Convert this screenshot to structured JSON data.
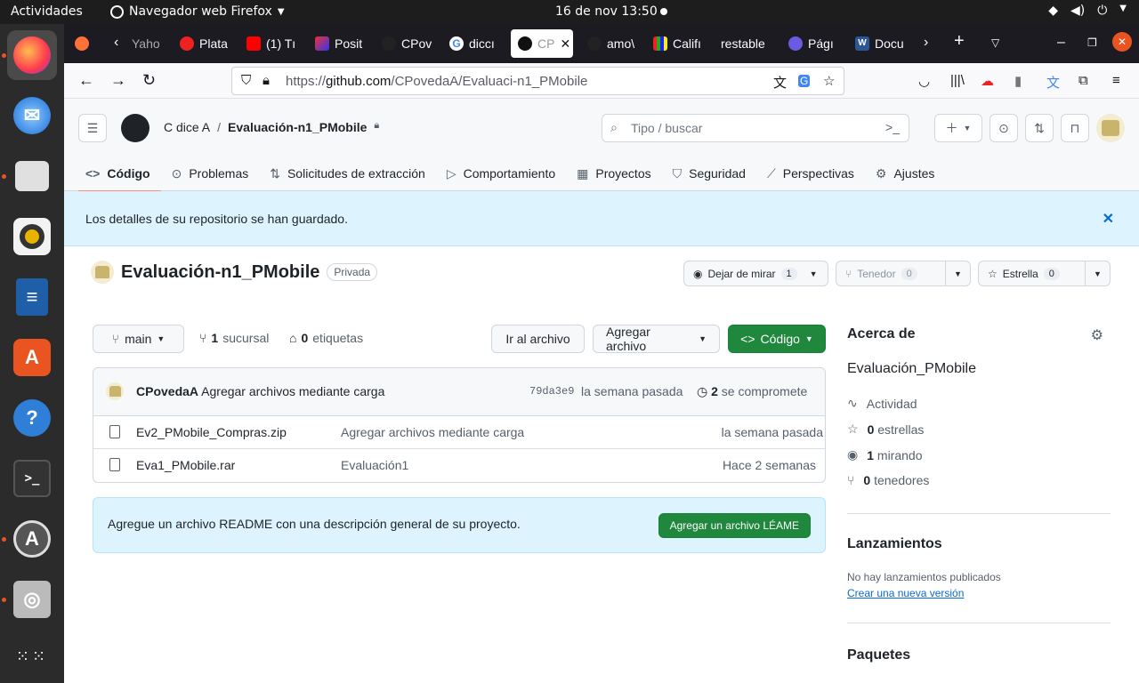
{
  "os": {
    "activities": "Actividades",
    "app_name": "Navegador web Firefox",
    "clock": "16 de nov  13:50"
  },
  "tabs": [
    {
      "label": "Yaho"
    },
    {
      "label": "Plata"
    },
    {
      "label": "(1) Tı"
    },
    {
      "label": "Posit"
    },
    {
      "label": "CPov"
    },
    {
      "label": "diccı"
    },
    {
      "label": "CP"
    },
    {
      "label": "amo\\"
    },
    {
      "label": "Califı"
    },
    {
      "label": "restable"
    },
    {
      "label": "Págı"
    },
    {
      "label": "Docu"
    }
  ],
  "url": {
    "prefix": "https://",
    "host": "github.com",
    "path": "/CPovedaA/Evaluaci-n1_PMobile"
  },
  "gh": {
    "owner": "C dice A",
    "repo_crumb": "Evaluación-n1_PMobile",
    "search_placeholder": "Tipo / buscar",
    "nav": [
      "Código",
      "Problemas",
      "Solicitudes de extracción",
      "Comportamiento",
      "Proyectos",
      "Seguridad",
      "Perspectivas",
      "Ajustes"
    ],
    "flash": "Los detalles de su repositorio se han guardado.",
    "repo_title": "Evaluación-n1_PMobile",
    "visibility": "Privada",
    "watch_label": "Dejar de mirar",
    "watch_count": "1",
    "fork_label": "Tenedor",
    "fork_count": "0",
    "star_label": "Estrella",
    "star_count": "0",
    "branch": "main",
    "branch_count": "1",
    "branch_label": "sucursal",
    "tag_count": "0",
    "tag_label": "etiquetas",
    "goto_file": "Ir al archivo",
    "add_file": "Agregar archivo",
    "code_btn": "Código",
    "commit": {
      "author": "CPovedaA",
      "message": "Agregar archivos mediante carga",
      "sha": "79da3e9",
      "when": "la semana pasada",
      "count": "2",
      "count_label": "se compromete"
    },
    "files": [
      {
        "name": "Ev2_PMobile_Compras.zip",
        "message": "Agregar archivos mediante carga",
        "when": "la semana pasada"
      },
      {
        "name": "Eva1_PMobile.rar",
        "message": "Evaluación1",
        "when": "Hace 2 semanas"
      }
    ],
    "readme_text": "Agregue un archivo README con una descripción general de su proyecto.",
    "readme_btn": "Agregar un archivo LÉAME",
    "about": {
      "title": "Acerca de",
      "description": "Evaluación_PMobile",
      "activity": "Actividad",
      "stars_count": "0",
      "stars_label": "estrellas",
      "watching_count": "1",
      "watching_label": "mirando",
      "forks_count": "0",
      "forks_label": "tenedores"
    },
    "releases": {
      "title": "Lanzamientos",
      "none": "No hay lanzamientos publicados",
      "create": "Crear una nueva versión"
    },
    "packages": {
      "title": "Paquetes"
    }
  }
}
